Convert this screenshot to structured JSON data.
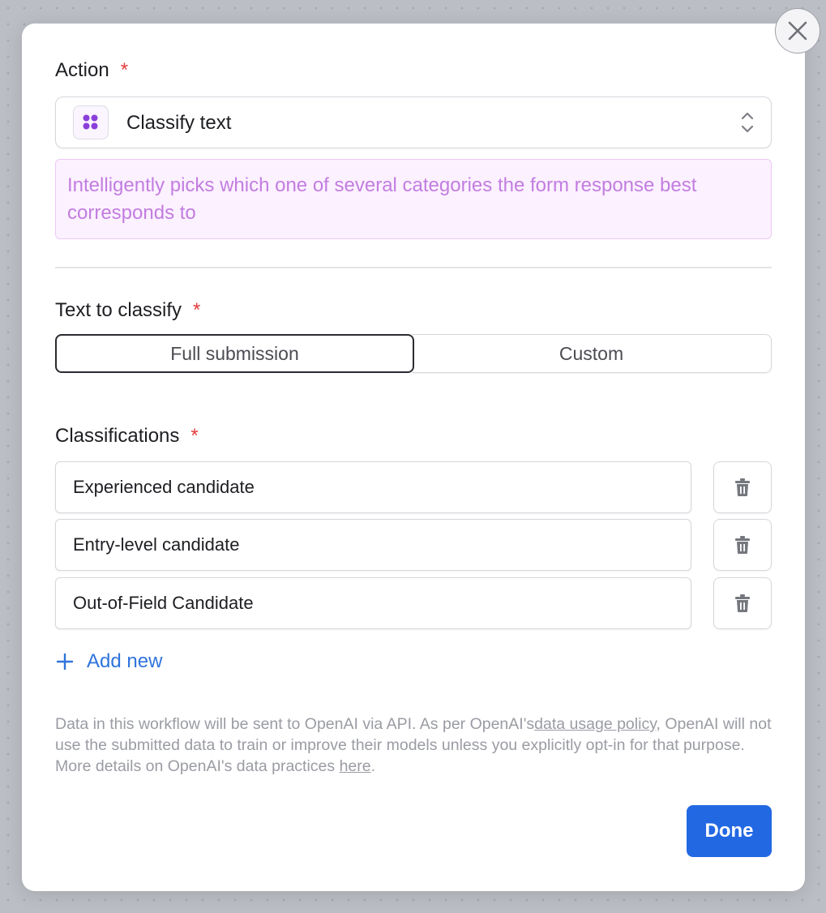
{
  "action": {
    "label": "Action",
    "required_mark": "*",
    "select": {
      "value": "Classify text",
      "icon": "grid-dots-icon"
    },
    "description": "Intelligently picks which one of several categories the form response best corresponds to"
  },
  "text_to_classify": {
    "label": "Text to classify",
    "required_mark": "*",
    "options": [
      "Full submission",
      "Custom"
    ],
    "selected": "Full submission"
  },
  "classifications": {
    "label": "Classifications",
    "required_mark": "*",
    "items": [
      {
        "value": "Experienced candidate"
      },
      {
        "value": "Entry-level candidate"
      },
      {
        "value": "Out-of-Field Candidate"
      }
    ],
    "add_new_label": "Add new"
  },
  "disclaimer": {
    "part1": "Data in this workflow will be sent to OpenAI via API. As per OpenAI's",
    "link1": "data usage policy",
    "part2": ", OpenAI will not use the submitted data to train or improve their models unless you explicitly opt-in for that purpose. More details on OpenAI's data practices",
    "link2": "here",
    "part3": "."
  },
  "footer": {
    "done_label": "Done"
  },
  "colors": {
    "accent_purple": "#8b3fd9",
    "primary_blue": "#2268e3",
    "link_blue": "#2f74dd",
    "required_red": "#e23b3b"
  }
}
